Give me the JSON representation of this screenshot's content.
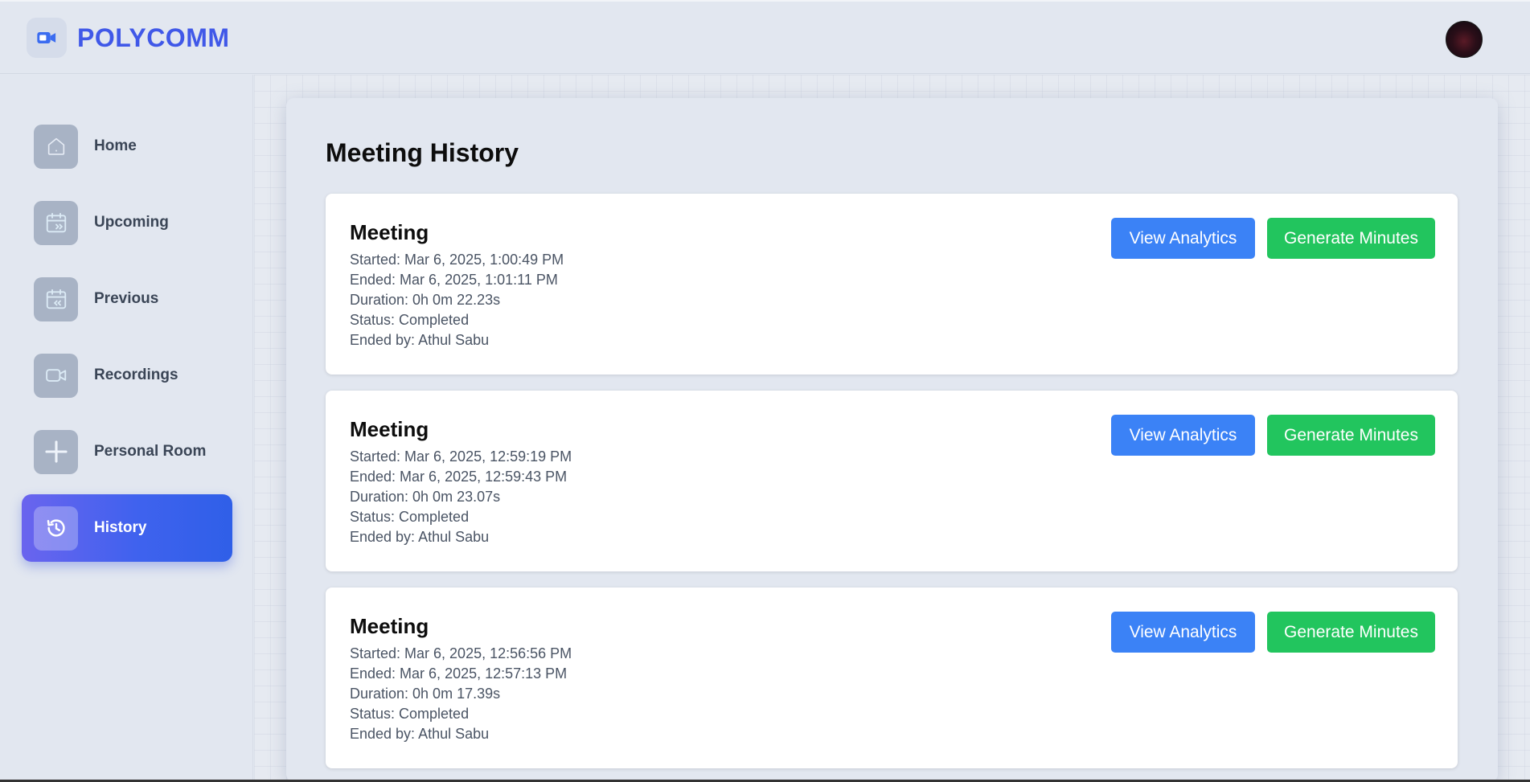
{
  "app": {
    "name": "POLYCOMM",
    "logo_icon": "video-camera-icon",
    "brand_color": "#4058e8"
  },
  "sidebar": {
    "items": [
      {
        "label": "Home",
        "icon": "home-icon",
        "active": false
      },
      {
        "label": "Upcoming",
        "icon": "calendar-upcoming-icon",
        "active": false
      },
      {
        "label": "Previous",
        "icon": "calendar-previous-icon",
        "active": false
      },
      {
        "label": "Recordings",
        "icon": "video-icon",
        "active": false
      },
      {
        "label": "Personal Room",
        "icon": "plus-icon",
        "active": false
      },
      {
        "label": "History",
        "icon": "history-icon",
        "active": true
      }
    ]
  },
  "main": {
    "title": "Meeting History",
    "meetings": [
      {
        "title": "Meeting",
        "started": "Started: Mar 6, 2025, 1:00:49 PM",
        "ended": "Ended: Mar 6, 2025, 1:01:11 PM",
        "duration": "Duration: 0h 0m 22.23s",
        "status": "Status: Completed",
        "ended_by": "Ended by: Athul Sabu"
      },
      {
        "title": "Meeting",
        "started": "Started: Mar 6, 2025, 12:59:19 PM",
        "ended": "Ended: Mar 6, 2025, 12:59:43 PM",
        "duration": "Duration: 0h 0m 23.07s",
        "status": "Status: Completed",
        "ended_by": "Ended by: Athul Sabu"
      },
      {
        "title": "Meeting",
        "started": "Started: Mar 6, 2025, 12:56:56 PM",
        "ended": "Ended: Mar 6, 2025, 12:57:13 PM",
        "duration": "Duration: 0h 0m 17.39s",
        "status": "Status: Completed",
        "ended_by": "Ended by: Athul Sabu"
      }
    ],
    "view_analytics_label": "View Analytics",
    "generate_minutes_label": "Generate Minutes",
    "analytics_color": "#3b82f6",
    "minutes_color": "#22c55e"
  }
}
